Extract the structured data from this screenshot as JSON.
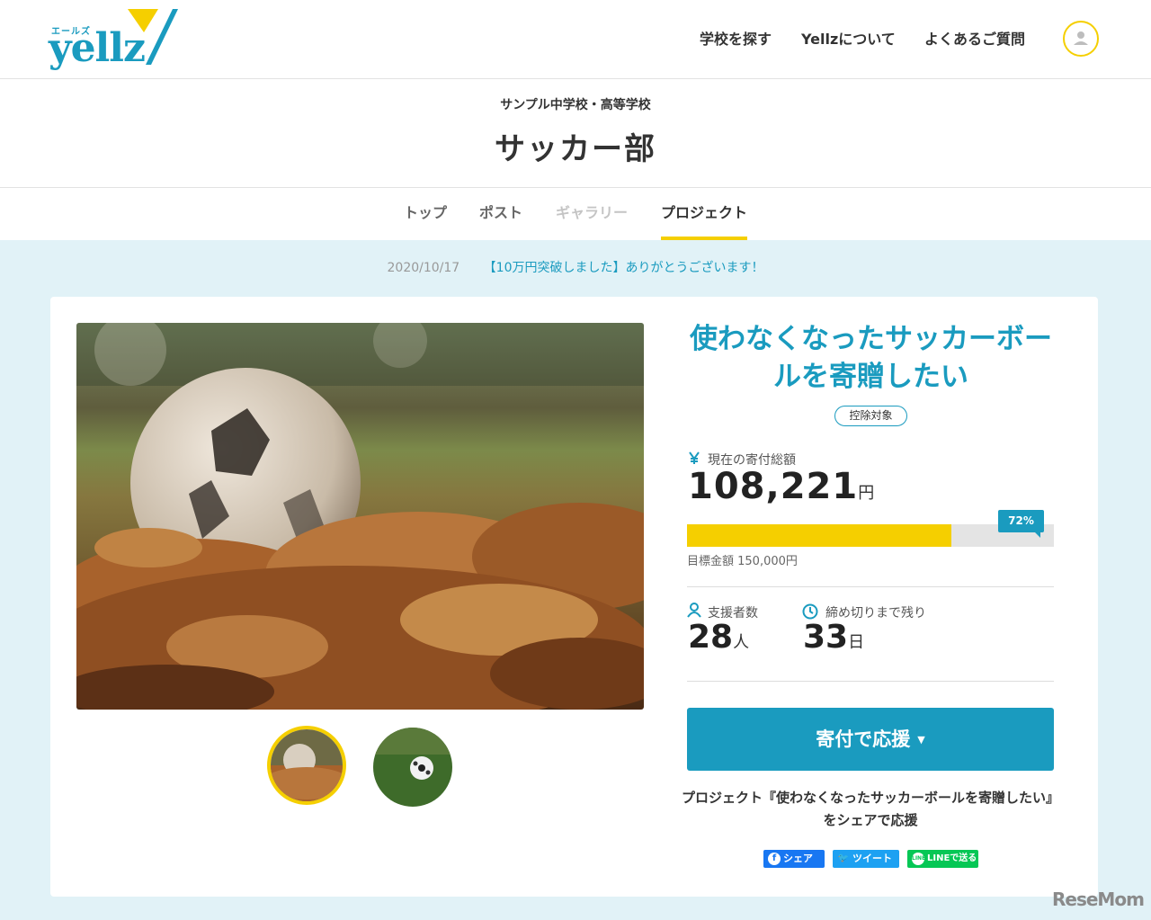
{
  "header": {
    "logo_kana": "エールズ",
    "logo_text": "yellz",
    "nav": [
      "学校を探す",
      "Yellzについて",
      "よくあるご質問"
    ]
  },
  "club": {
    "school": "サンプル中学校・高等学校",
    "name": "サッカー部"
  },
  "tabs": [
    {
      "label": "トップ",
      "state": "normal"
    },
    {
      "label": "ポスト",
      "state": "normal"
    },
    {
      "label": "ギャラリー",
      "state": "disabled"
    },
    {
      "label": "プロジェクト",
      "state": "active"
    }
  ],
  "news": {
    "date": "2020/10/17",
    "message": "【10万円突破しました】ありがとうございます！"
  },
  "project": {
    "title": "使わなくなったサッカーボールを寄贈したい",
    "badge": "控除対象",
    "raised_label": "現在の寄付総額",
    "raised_amount": "108,221",
    "raised_unit": "円",
    "progress_percent": 72,
    "progress_label": "72%",
    "goal_label": "目標金額 150,000円",
    "supporters_label": "支援者数",
    "supporters_value": "28",
    "supporters_unit": "人",
    "deadline_label": "締め切りまで残り",
    "deadline_value": "33",
    "deadline_unit": "日",
    "donate_button": "寄付で応援",
    "share_text": "プロジェクト『使わなくなったサッカーボールを寄贈したい』をシェアで応援",
    "share_buttons": {
      "facebook": "シェア",
      "twitter": "ツイート",
      "line": "LINEで送る"
    }
  },
  "colors": {
    "brand": "#1a9bbf",
    "accent": "#f5cf00",
    "background": "#e1f2f7",
    "facebook": "#1877f2",
    "twitter": "#1da1f2",
    "line": "#06c755"
  },
  "watermark": "ReseMom"
}
